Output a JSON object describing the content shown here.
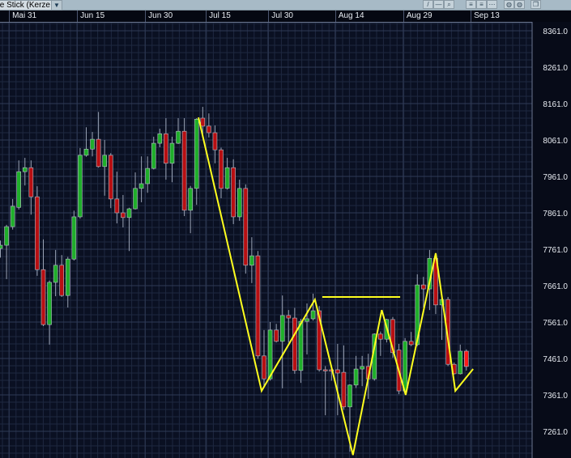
{
  "toolbar": {
    "chart_type_label": "e Stick (Kerze",
    "dropdown_icon": "chevron-down-icon",
    "tools": [
      {
        "icon": "line-draw-icon",
        "glyph": "/"
      },
      {
        "icon": "hline-icon",
        "glyph": "—"
      },
      {
        "icon": "magnifier-icon",
        "glyph": "⌕"
      },
      {
        "icon": "grid-lines-icon",
        "glyph": "≡"
      },
      {
        "icon": "grid-dash-icon",
        "glyph": "≡"
      },
      {
        "icon": "grid-dot-icon",
        "glyph": "⋯"
      },
      {
        "icon": "globe-icon",
        "glyph": "◍"
      },
      {
        "icon": "globe-dark-icon",
        "glyph": "◍"
      },
      {
        "icon": "window-icon",
        "glyph": "❐"
      }
    ]
  },
  "colors": {
    "up": "#1fae2a",
    "down": "#b80f12",
    "last": "#ff1a1a",
    "zigzag": "#ffff1e",
    "bg": "#0a1022",
    "grid": "#1e2840",
    "grid_major": "#2f3a55"
  },
  "chart_data": {
    "type": "candlestick",
    "title": "",
    "y_ticks": [
      "8361.0",
      "8261.0",
      "8161.0",
      "8061.0",
      "7961.0",
      "7861.0",
      "7761.0",
      "7661.0",
      "7561.0",
      "7461.0",
      "7361.0",
      "7261.0"
    ],
    "y_tick_values": [
      8361,
      8261,
      8161,
      8061,
      7961,
      7861,
      7761,
      7661,
      7561,
      7461,
      7361,
      7261
    ],
    "ylim": [
      7200,
      8385
    ],
    "x_ticks": [
      {
        "label": "Mai 31",
        "index": 1.4
      },
      {
        "label": "Jun 15",
        "index": 12.5
      },
      {
        "label": "Jun 30",
        "index": 23.6
      },
      {
        "label": "Jul 15",
        "index": 33.5
      },
      {
        "label": "Jul 30",
        "index": 43.7
      },
      {
        "label": "Aug 14",
        "index": 54.6
      },
      {
        "label": "Aug 29",
        "index": 65.7
      },
      {
        "label": "Sep 13",
        "index": 76.7
      }
    ],
    "ohlc": [
      [
        7763,
        7785,
        7738,
        7772
      ],
      [
        7772,
        7828,
        7679,
        7823
      ],
      [
        7823,
        7899,
        7815,
        7879
      ],
      [
        7876,
        8005,
        7870,
        7974
      ],
      [
        7974,
        8012,
        7936,
        7985
      ],
      [
        7985,
        8005,
        7856,
        7905
      ],
      [
        7905,
        7934,
        7688,
        7705
      ],
      [
        7705,
        7788,
        7550,
        7554
      ],
      [
        7554,
        7675,
        7499,
        7670
      ],
      [
        7670,
        7759,
        7632,
        7717
      ],
      [
        7717,
        7745,
        7630,
        7634
      ],
      [
        7634,
        7740,
        7601,
        7734
      ],
      [
        7734,
        7867,
        7730,
        7850
      ],
      [
        7850,
        8039,
        7845,
        8019
      ],
      [
        8019,
        8096,
        8015,
        8036
      ],
      [
        8036,
        8083,
        8016,
        8063
      ],
      [
        8063,
        8138,
        7985,
        7988
      ],
      [
        7988,
        8061,
        7908,
        8019
      ],
      [
        8019,
        8025,
        7874,
        7899
      ],
      [
        7899,
        7974,
        7832,
        7861
      ],
      [
        7861,
        7910,
        7821,
        7848
      ],
      [
        7848,
        7875,
        7756,
        7872
      ],
      [
        7872,
        7972,
        7870,
        7928
      ],
      [
        7928,
        8016,
        7890,
        7941
      ],
      [
        7941,
        8016,
        7916,
        7983
      ],
      [
        7983,
        8070,
        7980,
        8052
      ],
      [
        8052,
        8092,
        8041,
        8078
      ],
      [
        8078,
        8121,
        7952,
        7997
      ],
      [
        7997,
        8070,
        7945,
        8052
      ],
      [
        8052,
        8121,
        8050,
        8085
      ],
      [
        8085,
        8121,
        7852,
        7868
      ],
      [
        7868,
        7935,
        7805,
        7928
      ],
      [
        7928,
        8121,
        7883,
        8118
      ],
      [
        8121,
        8152,
        8068,
        8099
      ],
      [
        8099,
        8134,
        8068,
        8081
      ],
      [
        8081,
        8101,
        7997,
        8034
      ],
      [
        8034,
        8040,
        7901,
        7928
      ],
      [
        7928,
        8012,
        7925,
        7985
      ],
      [
        7985,
        8008,
        7830,
        7850
      ],
      [
        7850,
        7952,
        7839,
        7928
      ],
      [
        7928,
        7939,
        7694,
        7717
      ],
      [
        7717,
        7794,
        7668,
        7743
      ],
      [
        7743,
        7756,
        7460,
        7468
      ],
      [
        7468,
        7539,
        7383,
        7405
      ],
      [
        7405,
        7561,
        7400,
        7539
      ],
      [
        7539,
        7556,
        7505,
        7508
      ],
      [
        7508,
        7634,
        7379,
        7579
      ],
      [
        7579,
        7594,
        7505,
        7572
      ],
      [
        7572,
        7600,
        7419,
        7428
      ],
      [
        7428,
        7570,
        7394,
        7563
      ],
      [
        7563,
        7612,
        7472,
        7570
      ],
      [
        7570,
        7639,
        7565,
        7592
      ],
      [
        7592,
        7605,
        7425,
        7430
      ],
      [
        7430,
        7440,
        7305,
        7428
      ],
      [
        7430,
        7440,
        7400,
        7426
      ],
      [
        7430,
        7501,
        7305,
        7421
      ],
      [
        7423,
        7497,
        7320,
        7328
      ],
      [
        7328,
        7390,
        7205,
        7388
      ],
      [
        7388,
        7468,
        7380,
        7432
      ],
      [
        7432,
        7468,
        7385,
        7439
      ],
      [
        7439,
        7474,
        7350,
        7405
      ],
      [
        7405,
        7530,
        7400,
        7528
      ],
      [
        7528,
        7535,
        7468,
        7514
      ],
      [
        7514,
        7570,
        7505,
        7568
      ],
      [
        7568,
        7575,
        7463,
        7477
      ],
      [
        7484,
        7501,
        7363,
        7372
      ],
      [
        7372,
        7517,
        7370,
        7508
      ],
      [
        7508,
        7534,
        7495,
        7499
      ],
      [
        7499,
        7692,
        7495,
        7663
      ],
      [
        7663,
        7685,
        7601,
        7652
      ],
      [
        7652,
        7759,
        7594,
        7736
      ],
      [
        7736,
        7745,
        7583,
        7608
      ],
      [
        7608,
        7630,
        7512,
        7623
      ],
      [
        7623,
        7630,
        7440,
        7445
      ],
      [
        7445,
        7450,
        7417,
        7419
      ],
      [
        7419,
        7499,
        7417,
        7481
      ],
      [
        7481,
        7486,
        7428,
        7439
      ]
    ],
    "zigzag": [
      [
        32.3,
        8123
      ],
      [
        42.6,
        7372
      ],
      [
        51.3,
        7623
      ],
      [
        57.5,
        7196
      ],
      [
        62.2,
        7594
      ],
      [
        66.1,
        7361
      ],
      [
        71.0,
        7750
      ],
      [
        74.2,
        7372
      ],
      [
        77.1,
        7432
      ]
    ],
    "hline": {
      "from": 52.5,
      "to": 65.2,
      "price": 7630
    }
  }
}
